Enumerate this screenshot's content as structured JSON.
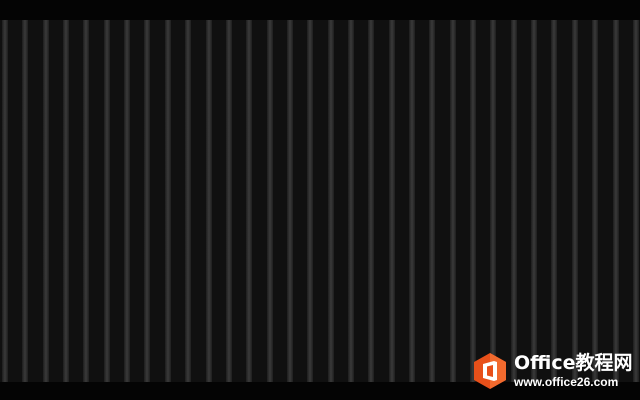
{
  "watermark": {
    "title": "Office教程网",
    "url": "www.office26.com",
    "logo_icon": "office-logo-icon",
    "accent_color": "#e8501a"
  },
  "colors": {
    "background": "#050505",
    "stripe_base": "#101010",
    "stripe_light": "#3a3a3a"
  }
}
